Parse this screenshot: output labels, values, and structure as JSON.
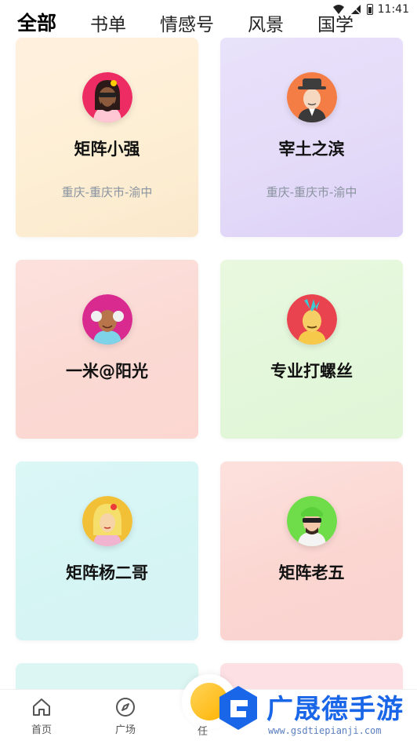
{
  "status_bar": {
    "time": "11:41"
  },
  "tabs": [
    {
      "label": "全部",
      "active": true
    },
    {
      "label": "书单",
      "active": false
    },
    {
      "label": "情感号",
      "active": false
    },
    {
      "label": "风景",
      "active": false
    },
    {
      "label": "国学",
      "active": false
    }
  ],
  "cards": [
    {
      "name": "矩阵小强",
      "location": "重庆-重庆市-渝中"
    },
    {
      "name": "宰土之滨",
      "location": "重庆-重庆市-渝中"
    },
    {
      "name": "一米@阳光"
    },
    {
      "name": "专业打螺丝"
    },
    {
      "name": "矩阵杨二哥"
    },
    {
      "name": "矩阵老五"
    }
  ],
  "bottom_nav": {
    "home": "首页",
    "square": "广场",
    "task": "任"
  },
  "watermark": {
    "text": "广晟德手游",
    "url": "www.gsdtiepianji.com"
  }
}
